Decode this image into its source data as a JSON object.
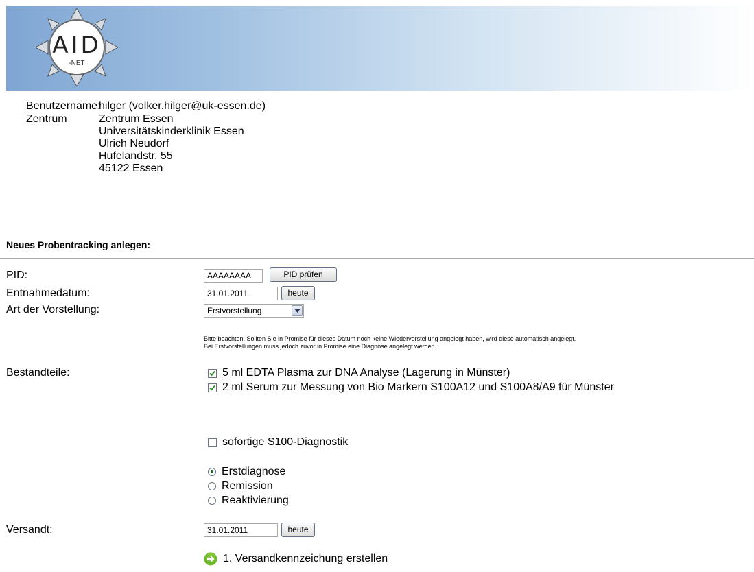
{
  "header": {
    "logo_text": "AID",
    "logo_sub": "-NET"
  },
  "user": {
    "username_label": "Benutzername:",
    "username_value": "hilger (volker.hilger@uk-essen.de)",
    "center_label": "Zentrum",
    "center_lines": [
      "Zentrum Essen",
      "Universitätskinderklinik Essen",
      "Ulrich Neudorf",
      "Hufelandstr. 55",
      "45122 Essen"
    ]
  },
  "form": {
    "title": "Neues Probentracking anlegen:",
    "pid_label": "PID:",
    "pid_value": "AAAAAAAA",
    "pid_check_button": "PID prüfen",
    "date_label": "Entnahmedatum:",
    "date_value": "31.01.2011",
    "today_button": "heute",
    "visit_label": "Art der Vorstellung:",
    "visit_value": "Erstvorstellung",
    "note_line1": "Bitte beachten: Sollten Sie in Promise für dieses Datum noch keine Wiedervorstellung angelegt haben, wird diese automatisch angelegt.",
    "note_line2": "Bei Erstvorstellungen muss jedoch zuvor in Promise eine Diagnose angelegt werden.",
    "components_label": "Bestandteile:",
    "components": [
      {
        "label": "5 ml EDTA Plasma zur DNA Analyse (Lagerung in Münster)",
        "checked": true
      },
      {
        "label": "2 ml Serum zur Messung von Bio Markern S100A12 und S100A8/A9 für Münster",
        "checked": true
      }
    ],
    "immediate_diag": {
      "label": "sofortige S100-Diagnostik",
      "checked": false
    },
    "diagnosis_options": [
      {
        "label": "Erstdiagnose",
        "selected": true
      },
      {
        "label": "Remission",
        "selected": false
      },
      {
        "label": "Reaktivierung",
        "selected": false
      }
    ],
    "shipped_label": "Versandt:",
    "shipped_value": "31.01.2011",
    "shipped_today_button": "heute",
    "next_step_label": "1. Versandkennzeichung erstellen"
  },
  "colors": {
    "banner_start": "#7fa6d3",
    "banner_end": "#ffffff",
    "checkbox_check": "#2c8a2c",
    "next_icon": "#6bb829"
  }
}
